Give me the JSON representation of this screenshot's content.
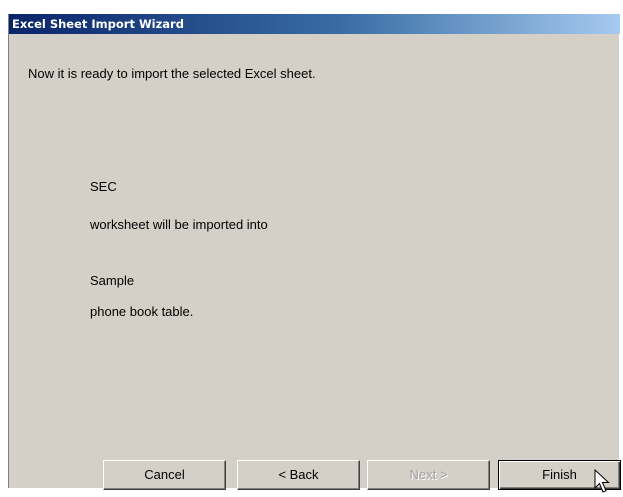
{
  "window": {
    "title": "Excel Sheet Import Wizard"
  },
  "content": {
    "instruction": "Now it is ready to import the selected Excel sheet.",
    "sheet_name": "SEC",
    "sheet_text": "worksheet will be imported into",
    "table_name": "Sample",
    "table_text": "phone book table."
  },
  "buttons": {
    "cancel": "Cancel",
    "back": "< Back",
    "next": "Next >",
    "finish": "Finish"
  },
  "state": {
    "next_enabled": false,
    "default_button": "finish"
  },
  "icons": {
    "cursor": "mouse-pointer-icon"
  },
  "colors": {
    "dialog_background": "#d4d0c8",
    "titlebar_start": "#0a246a",
    "titlebar_end": "#a6caf0",
    "disabled_text": "#a0a0a0"
  }
}
